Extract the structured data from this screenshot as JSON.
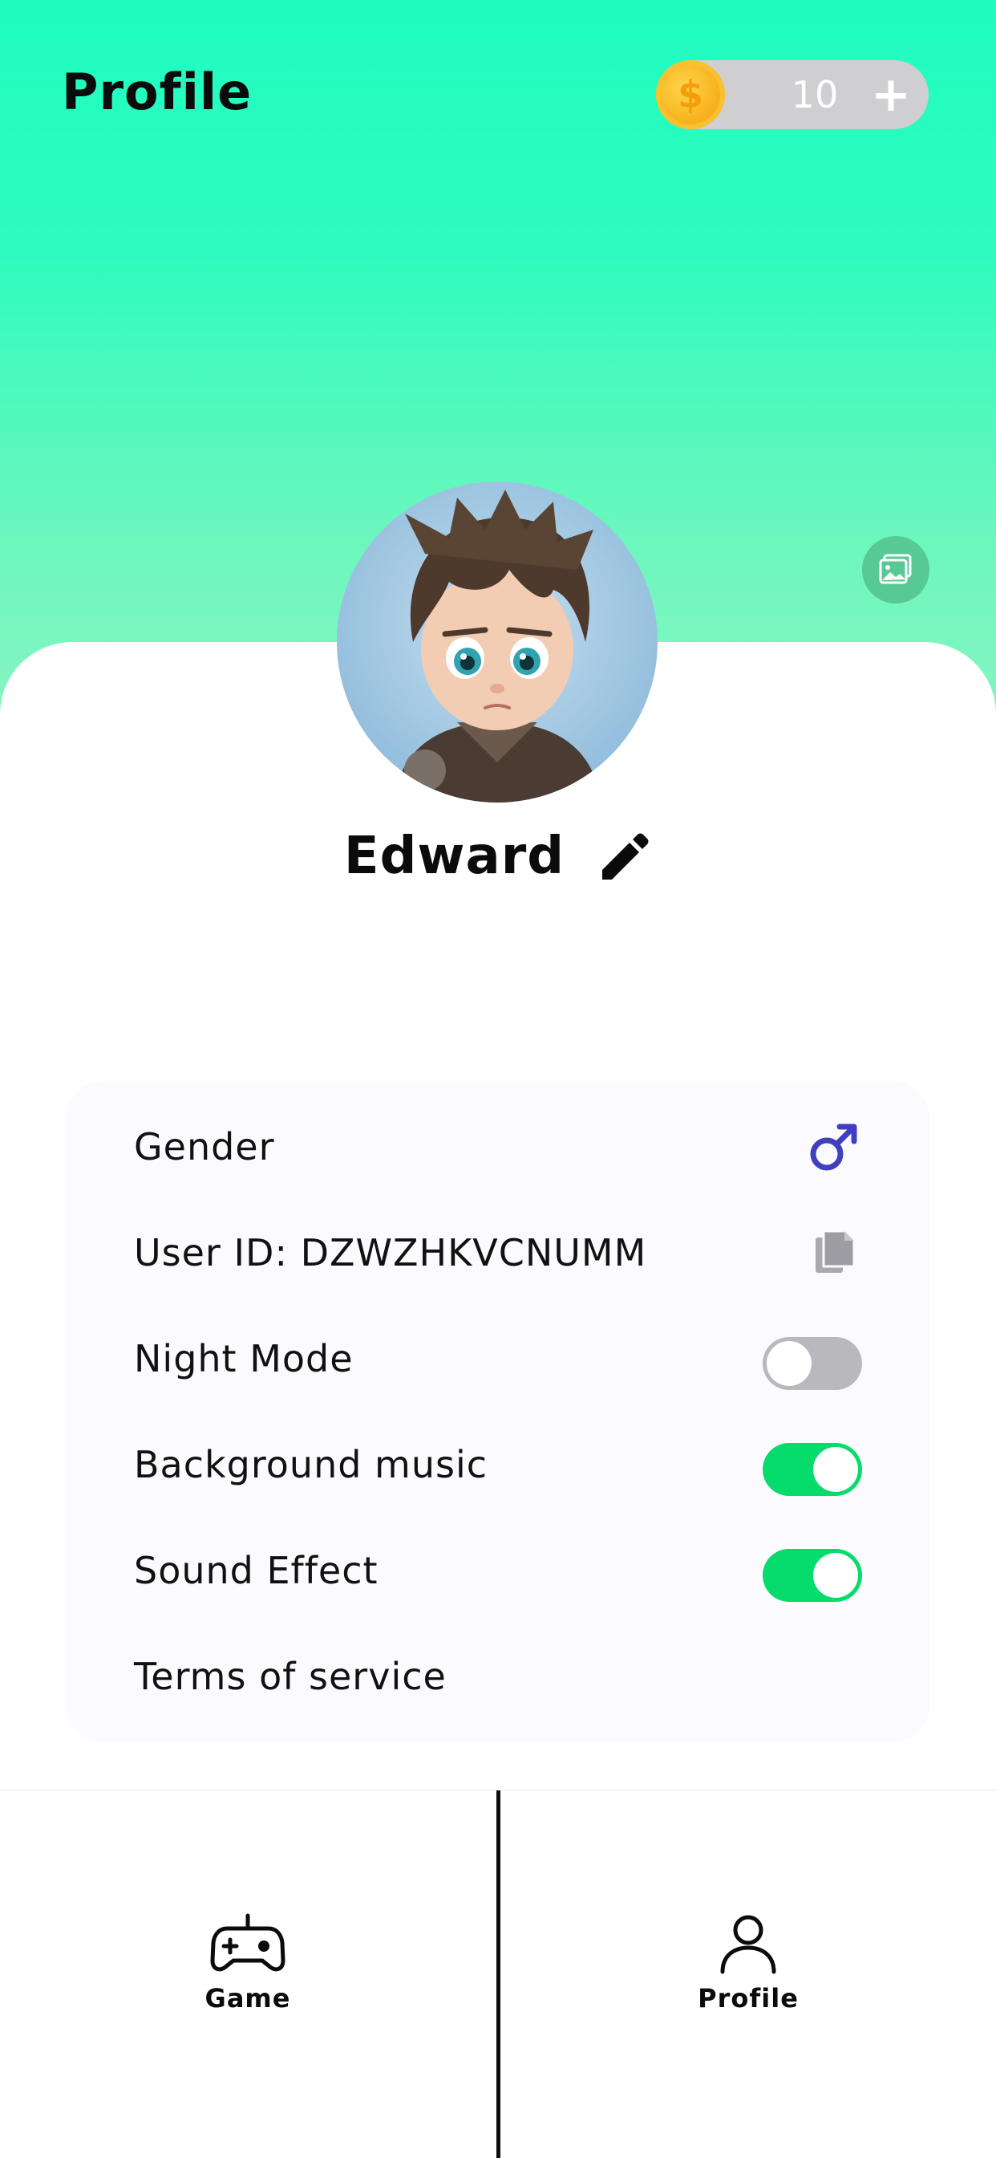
{
  "header": {
    "title": "Profile",
    "coins": {
      "count": "10",
      "currency_symbol": "$",
      "add_label": "+"
    }
  },
  "profile": {
    "name": "Edward"
  },
  "settings": {
    "rows": [
      {
        "label": "Gender",
        "control": "male-icon"
      },
      {
        "label": "User ID: DZWZHKVCNUMM",
        "control": "copy-icon"
      },
      {
        "label": "Night Mode",
        "control": "toggle",
        "enabled": false
      },
      {
        "label": "Background music",
        "control": "toggle",
        "enabled": true
      },
      {
        "label": "Sound Effect",
        "control": "toggle",
        "enabled": true
      },
      {
        "label": "Terms of service",
        "control": "none"
      }
    ]
  },
  "tabbar": {
    "tabs": [
      {
        "label": "Game",
        "icon": "gamepad-icon"
      },
      {
        "label": "Profile",
        "icon": "person-icon"
      }
    ]
  },
  "colors": {
    "header_gradient_top": "#1ffcc0",
    "header_gradient_bottom": "#86f4c1",
    "toggle_on": "#06dc6c",
    "toggle_off": "#b9b8bd",
    "gender_icon": "#3f3fbf"
  }
}
